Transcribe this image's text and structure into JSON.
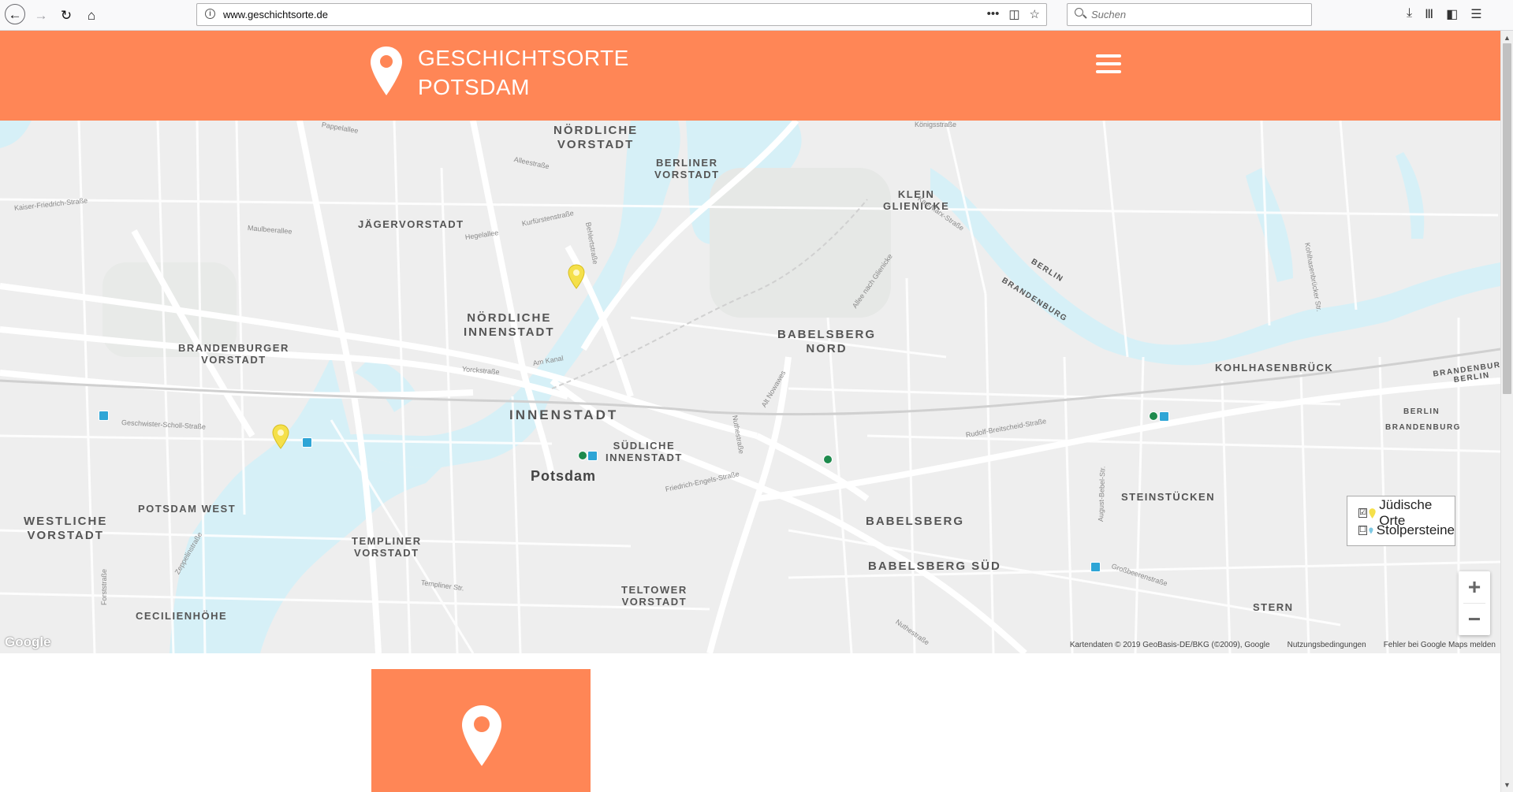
{
  "browser": {
    "url": "www.geschichtsorte.de",
    "search_placeholder": "Suchen",
    "url_actions": "•••"
  },
  "header": {
    "title_line1": "GESCHICHTSORTE",
    "title_line2": "POTSDAM",
    "accent_color": "#ff8656"
  },
  "map": {
    "districts": [
      {
        "text": "NÖRDLICHE\nVORSTADT"
      },
      {
        "text": "BERLINER\nVORSTADT"
      },
      {
        "text": "JÄGERVORSTADT"
      },
      {
        "text": "KLEIN\nGLIENICKE"
      },
      {
        "text": "NÖRDLICHE\nINNENSTADT"
      },
      {
        "text": "BABELSBERG\nNORD"
      },
      {
        "text": "BRANDENBURGER\nVORSTADT"
      },
      {
        "text": "KOHLHASENBRÜCK"
      },
      {
        "text": "INNENSTADT"
      },
      {
        "text": "SÜDLICHE\nINNENSTADT"
      },
      {
        "text": "Potsdam"
      },
      {
        "text": "STEINSTÜCKEN"
      },
      {
        "text": "POTSDAM WEST"
      },
      {
        "text": "WESTLICHE\nVORSTADT"
      },
      {
        "text": "BABELSBERG"
      },
      {
        "text": "TEMPLINER\nVORSTADT"
      },
      {
        "text": "BABELSBERG SÜD"
      },
      {
        "text": "TELTOWER\nVORSTADT"
      },
      {
        "text": "STERN"
      },
      {
        "text": "CECILIENHÖHE"
      },
      {
        "text": "BERLIN"
      },
      {
        "text": "BRANDENBURG"
      },
      {
        "text": "BERLIN"
      },
      {
        "text": "BRANDENBURG"
      },
      {
        "text": "BRANDENBURG\nBERLIN"
      }
    ],
    "streets": [
      {
        "text": "Königsstraße"
      },
      {
        "text": "Pappelallee"
      },
      {
        "text": "Alleestraße"
      },
      {
        "text": "Kaiser-Friedrich-Straße"
      },
      {
        "text": "Maulbeerallee"
      },
      {
        "text": "Hegelallee"
      },
      {
        "text": "Kurfürstenstraße"
      },
      {
        "text": "Behlertstraße"
      },
      {
        "text": "Karl-Marx-Straße"
      },
      {
        "text": "Allee nach Glienicke"
      },
      {
        "text": "Yorckstraße"
      },
      {
        "text": "Am Kanal"
      },
      {
        "text": "Geschwister-Scholl-Straße"
      },
      {
        "text": "Friedrich-Engels-Straße"
      },
      {
        "text": "Nuthestraße"
      },
      {
        "text": "Alt Nowawes"
      },
      {
        "text": "Rudolf-Breitscheid-Straße"
      },
      {
        "text": "Zeppelinstraße"
      },
      {
        "text": "Templiner Str."
      },
      {
        "text": "Großbeerenstraße"
      },
      {
        "text": "August-Bebel-Str."
      },
      {
        "text": "Nuthestraße"
      },
      {
        "text": "Forststraße"
      },
      {
        "text": "Kohlhasenbrücker Str."
      }
    ],
    "legend": {
      "item1_label": "Jüdische Orte",
      "item1_checked": "☑",
      "item2_label": "Stolpersteine",
      "item2_checked": "☐"
    },
    "zoom_in": "+",
    "zoom_out": "−",
    "google_logo": "Google",
    "attribution": {
      "data": "Kartendaten © 2019 GeoBasis-DE/BKG (©2009), Google",
      "terms": "Nutzungsbedingungen",
      "report": "Fehler bei Google Maps melden"
    },
    "pin_color_jewish": "#f5e04a",
    "pin_color_stolpersteine": "#7ec8e3"
  }
}
